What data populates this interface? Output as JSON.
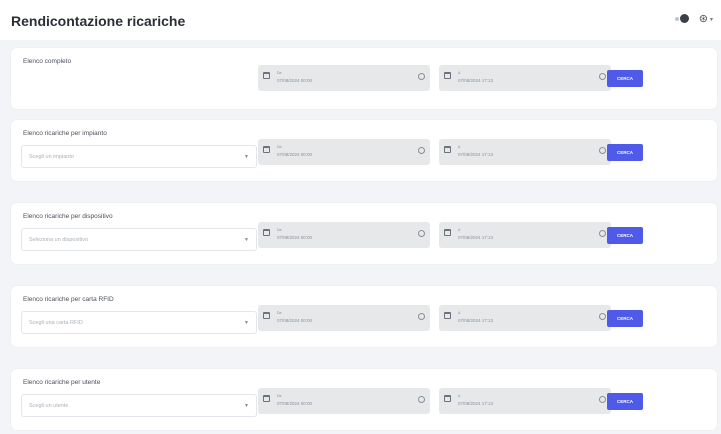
{
  "page_title": "Rendicontazione ricariche",
  "date_from_label": "Da",
  "date_to_label": "A",
  "date_from_value": "07/08/2024 00:00",
  "date_to_value": "07/08/2024 17:13",
  "search_label": "CERCA",
  "cards": [
    {
      "title": "Elenco completo",
      "placeholder": ""
    },
    {
      "title": "Elenco ricariche per impianto",
      "placeholder": "Scegli un impianto"
    },
    {
      "title": "Elenco ricariche per dispositivo",
      "placeholder": "Seleziona un dispositivo"
    },
    {
      "title": "Elenco ricariche per carta RFID",
      "placeholder": "Scegli una carta RFID"
    },
    {
      "title": "Elenco ricariche per utente",
      "placeholder": "Scegli un utente"
    }
  ],
  "colors": {
    "accent": "#4f5be8",
    "card": "#ffffff",
    "background": "#f3f4f7"
  },
  "icons": {
    "theme": "toggle-icon",
    "user": "user-icon",
    "calendar": "calendar-icon",
    "clock": "clock-icon"
  }
}
